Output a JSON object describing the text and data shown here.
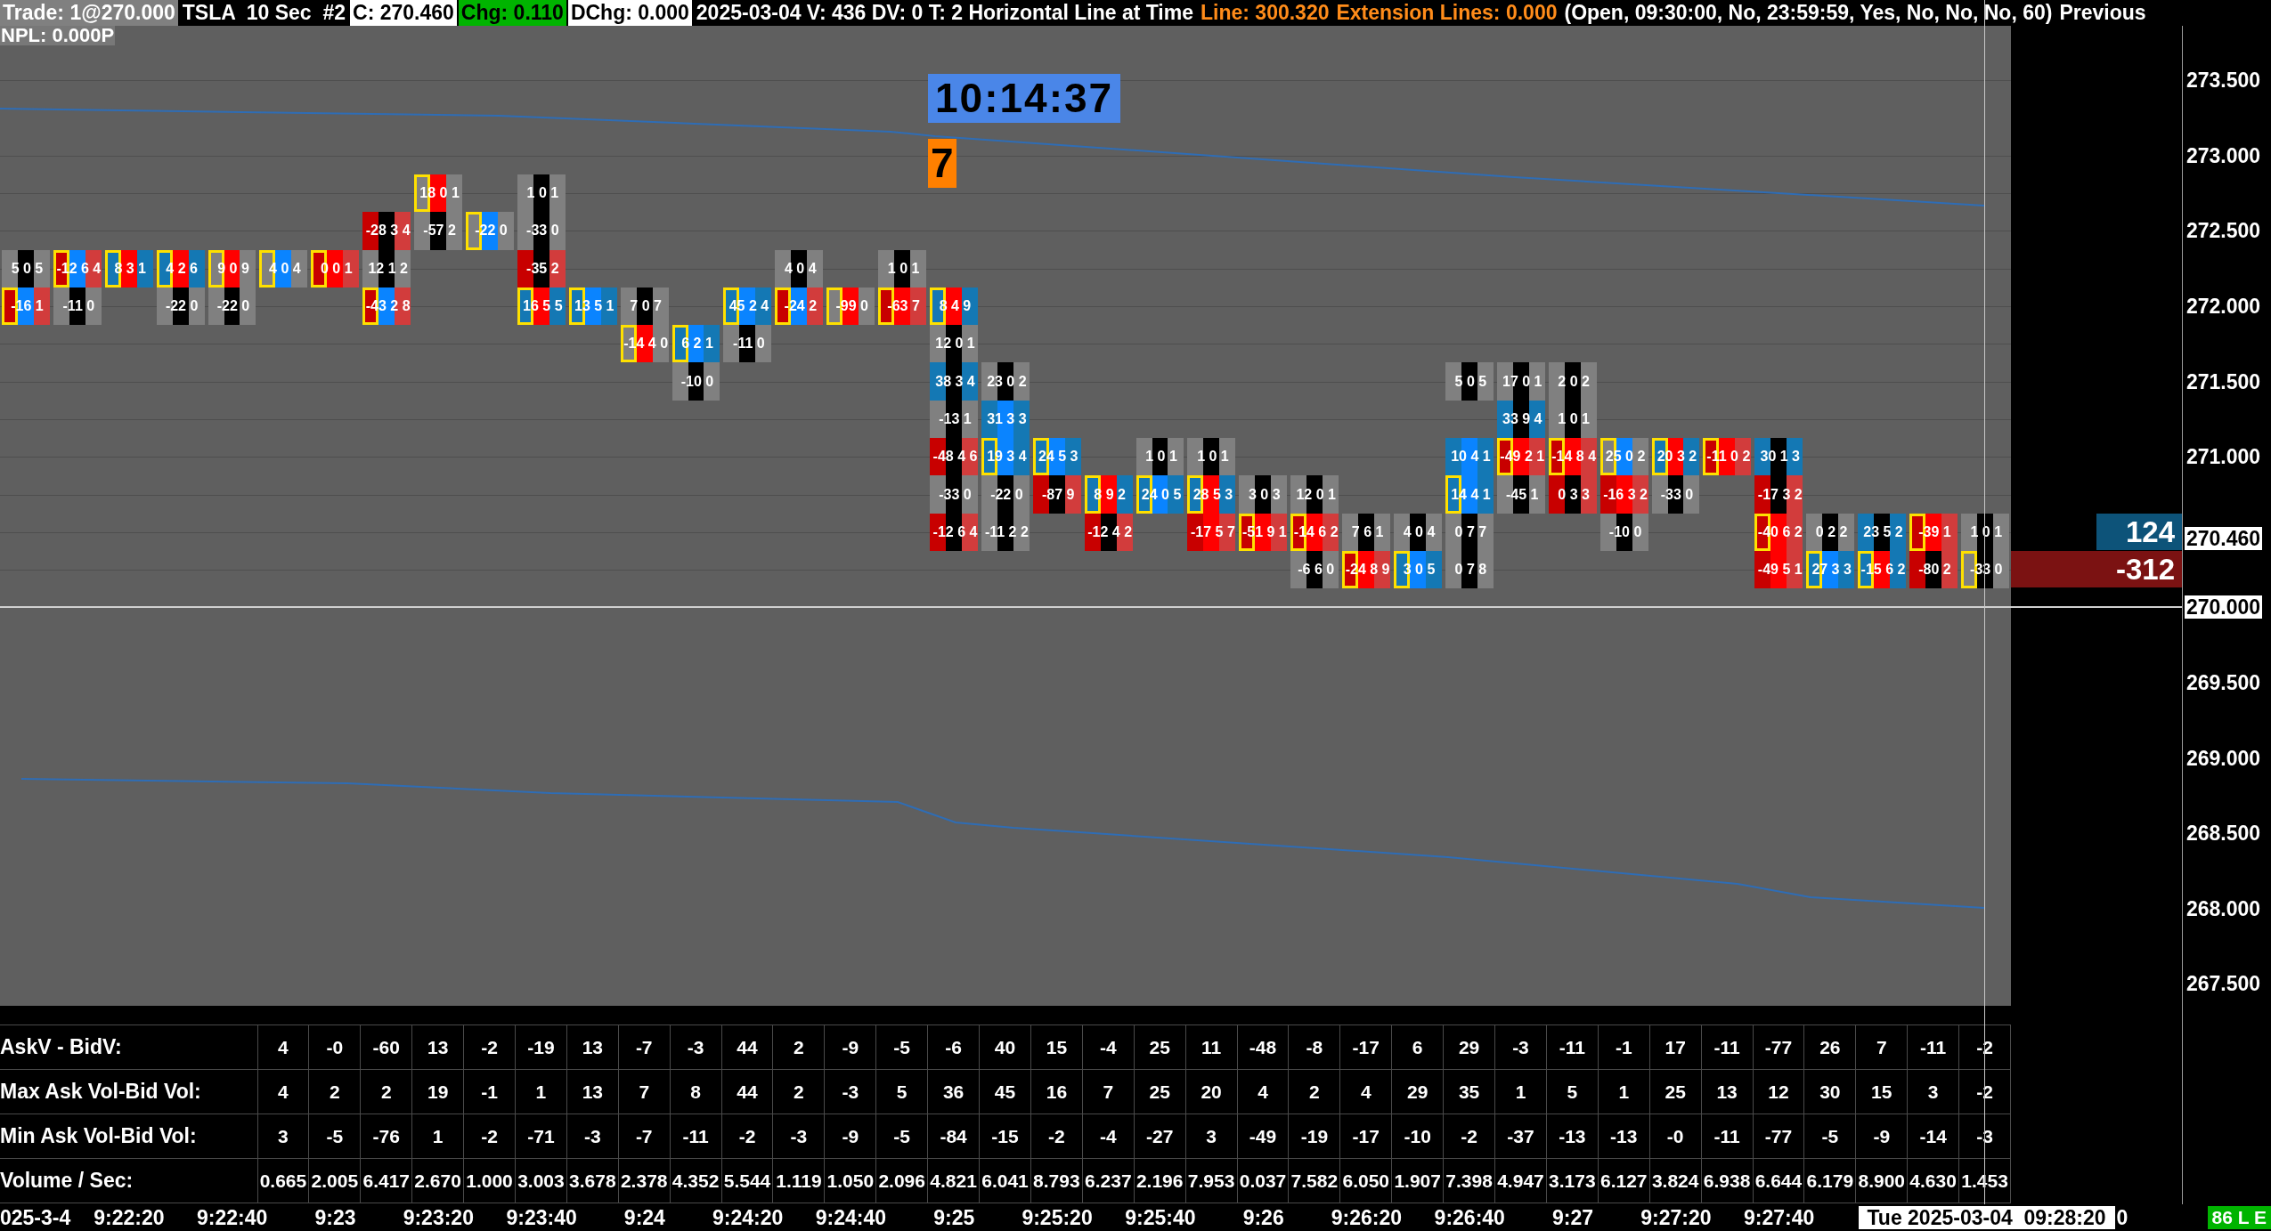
{
  "header": {
    "segments": [
      {
        "text": "Trade: 1@270.000",
        "kind": "muted"
      },
      {
        "text": "TSLA  10 Sec  #2",
        "kind": "inverse"
      },
      {
        "text": "C: 270.460",
        "kind": "light"
      },
      {
        "text": "Chg: 0.110",
        "kind": "positive"
      },
      {
        "text": "DChg: 0.000",
        "kind": "light"
      },
      {
        "text": "2025-03-04 V: 436 DV: 0 T: 2 Horizontal Line at Time",
        "kind": "inverse"
      },
      {
        "text": "Line: 300.320",
        "kind": "accent"
      },
      {
        "text": "Extension Lines: 0.000",
        "kind": "accent"
      },
      {
        "text": "(Open, 09:30:00, No, 23:59:59, Yes, No, No, No, 60)",
        "kind": "inverse"
      },
      {
        "text": "Previous",
        "kind": "inverse"
      }
    ]
  },
  "chart": {
    "pnl": "NPL: 0.000P",
    "timer": "10:14:37",
    "countdown": "7",
    "bars": [
      {
        "cells": [
          {
            "kind": "empty"
          },
          {
            "kind": "empty"
          },
          {
            "text": "5 0 5",
            "kind": "neutral",
            "highlighted": false
          },
          {
            "text": "-16 1",
            "kind": "splitsell",
            "highlighted": true
          }
        ]
      },
      {
        "cells": [
          {
            "kind": "empty"
          },
          {
            "kind": "empty"
          },
          {
            "text": "-12 6 4",
            "kind": "splitsell",
            "highlighted": true
          },
          {
            "text": "-11 0",
            "kind": "neutral",
            "highlighted": false
          }
        ]
      },
      {
        "cells": [
          {
            "kind": "empty"
          },
          {
            "kind": "empty"
          },
          {
            "text": "8 3 1",
            "kind": "splitbuy",
            "highlighted": true
          }
        ]
      },
      {
        "cells": [
          {
            "kind": "empty"
          },
          {
            "kind": "empty"
          },
          {
            "text": "4 2 6",
            "kind": "splitbuy",
            "highlighted": true
          },
          {
            "text": "-22 0",
            "kind": "neutral",
            "highlighted": false
          }
        ]
      },
      {
        "cells": [
          {
            "kind": "empty"
          },
          {
            "kind": "empty"
          },
          {
            "text": "9 0 9",
            "kind": "graysell",
            "highlighted": true
          },
          {
            "text": "-22 0",
            "kind": "neutral",
            "highlighted": false
          }
        ]
      },
      {
        "cells": [
          {
            "kind": "empty"
          },
          {
            "kind": "empty"
          },
          {
            "text": "4 0 4",
            "kind": "graybuy",
            "highlighted": true
          }
        ]
      },
      {
        "cells": [
          {
            "kind": "empty"
          },
          {
            "kind": "empty"
          },
          {
            "text": "0 0 1",
            "kind": "sell",
            "highlighted": true
          }
        ]
      },
      {
        "cells": [
          {
            "kind": "empty"
          },
          {
            "text": "-28 3 4",
            "kind": "thinsell",
            "highlighted": false
          },
          {
            "text": "12 1 2",
            "kind": "neutral",
            "highlighted": false
          },
          {
            "text": "-43 2 8",
            "kind": "splitsell",
            "highlighted": true
          }
        ]
      },
      {
        "cells": [
          {
            "text": "18 0 1",
            "kind": "graysell",
            "highlighted": true
          },
          {
            "text": "-57 2",
            "kind": "neutral",
            "highlighted": false
          }
        ]
      },
      {
        "cells": [
          {
            "kind": "empty"
          },
          {
            "text": "-22 0",
            "kind": "graybuy",
            "highlighted": true
          }
        ]
      },
      {
        "cells": [
          {
            "text": "1 0 1",
            "kind": "neutral",
            "highlighted": false
          },
          {
            "text": "-33 0",
            "kind": "neutral",
            "highlighted": false
          },
          {
            "text": "-35 2",
            "kind": "thinsell",
            "highlighted": false
          },
          {
            "text": "16 5 5",
            "kind": "splitbuy",
            "highlighted": true
          }
        ]
      },
      {
        "cells": [
          {
            "kind": "empty"
          },
          {
            "kind": "empty"
          },
          {
            "kind": "empty"
          },
          {
            "text": "13 5 1",
            "kind": "buy",
            "highlighted": true
          }
        ]
      },
      {
        "cells": [
          {
            "kind": "empty"
          },
          {
            "kind": "empty"
          },
          {
            "kind": "empty"
          },
          {
            "text": "7 0 7",
            "kind": "neutral",
            "highlighted": false
          },
          {
            "text": "-14 4 0",
            "kind": "graysell",
            "highlighted": true
          }
        ]
      },
      {
        "cells": [
          {
            "kind": "empty"
          },
          {
            "kind": "empty"
          },
          {
            "kind": "empty"
          },
          {
            "kind": "empty"
          },
          {
            "text": "6 2 1",
            "kind": "buy",
            "highlighted": true
          },
          {
            "text": "-10 0",
            "kind": "neutral",
            "highlighted": false
          }
        ]
      },
      {
        "cells": [
          {
            "kind": "empty"
          },
          {
            "kind": "empty"
          },
          {
            "kind": "empty"
          },
          {
            "text": "45 2 4",
            "kind": "buy",
            "highlighted": true
          },
          {
            "text": "-11 0",
            "kind": "neutral",
            "highlighted": false
          }
        ]
      },
      {
        "cells": [
          {
            "kind": "empty"
          },
          {
            "kind": "empty"
          },
          {
            "text": "4 0 4",
            "kind": "neutral",
            "highlighted": false
          },
          {
            "text": "-24 2",
            "kind": "splitsell",
            "highlighted": true
          }
        ]
      },
      {
        "cells": [
          {
            "kind": "empty"
          },
          {
            "kind": "empty"
          },
          {
            "kind": "empty"
          },
          {
            "text": "-99 0",
            "kind": "graysell",
            "highlighted": true
          }
        ]
      },
      {
        "cells": [
          {
            "kind": "empty"
          },
          {
            "kind": "empty"
          },
          {
            "text": "1 0 1",
            "kind": "neutral",
            "highlighted": false
          },
          {
            "text": "-63 7",
            "kind": "sell",
            "highlighted": true
          }
        ]
      },
      {
        "cells": [
          {
            "kind": "empty"
          },
          {
            "kind": "empty"
          },
          {
            "kind": "empty"
          },
          {
            "text": "8 4 9",
            "kind": "splitbuy",
            "highlighted": true
          },
          {
            "text": "12 0 1",
            "kind": "neutral",
            "highlighted": false
          },
          {
            "text": "38 3 4",
            "kind": "thinbuy",
            "highlighted": false
          },
          {
            "text": "-13 1",
            "kind": "neutral",
            "highlighted": false
          },
          {
            "text": "-48 4 6",
            "kind": "thinsell",
            "highlighted": false
          },
          {
            "text": "-33 0",
            "kind": "neutral",
            "highlighted": false
          },
          {
            "text": "-12 6 4",
            "kind": "thinsell",
            "highlighted": false
          }
        ]
      },
      {
        "cells": [
          {
            "kind": "empty"
          },
          {
            "kind": "empty"
          },
          {
            "kind": "empty"
          },
          {
            "kind": "empty"
          },
          {
            "kind": "empty"
          },
          {
            "text": "23 0 2",
            "kind": "neutral",
            "highlighted": false
          },
          {
            "text": "31 3 3",
            "kind": "buy",
            "highlighted": false
          },
          {
            "text": "19 3 4",
            "kind": "buy",
            "highlighted": true
          },
          {
            "text": "-22 0",
            "kind": "neutral",
            "highlighted": false
          },
          {
            "text": "-11 2 2",
            "kind": "neutral",
            "highlighted": false
          }
        ]
      },
      {
        "cells": [
          {
            "kind": "empty"
          },
          {
            "kind": "empty"
          },
          {
            "kind": "empty"
          },
          {
            "kind": "empty"
          },
          {
            "kind": "empty"
          },
          {
            "kind": "empty"
          },
          {
            "kind": "empty"
          },
          {
            "text": "24 5 3",
            "kind": "buy",
            "highlighted": true
          },
          {
            "text": "-87 9",
            "kind": "thinsell",
            "highlighted": false
          }
        ]
      },
      {
        "cells": [
          {
            "kind": "empty"
          },
          {
            "kind": "empty"
          },
          {
            "kind": "empty"
          },
          {
            "kind": "empty"
          },
          {
            "kind": "empty"
          },
          {
            "kind": "empty"
          },
          {
            "kind": "empty"
          },
          {
            "kind": "empty"
          },
          {
            "text": "8 9 2",
            "kind": "splitbuy",
            "highlighted": true
          },
          {
            "text": "-12 4 2",
            "kind": "thinsell",
            "highlighted": false
          }
        ]
      },
      {
        "cells": [
          {
            "kind": "empty"
          },
          {
            "kind": "empty"
          },
          {
            "kind": "empty"
          },
          {
            "kind": "empty"
          },
          {
            "kind": "empty"
          },
          {
            "kind": "empty"
          },
          {
            "kind": "empty"
          },
          {
            "text": "1 0 1",
            "kind": "neutral",
            "highlighted": false
          },
          {
            "text": "24 0 5",
            "kind": "buy",
            "highlighted": true
          }
        ]
      },
      {
        "cells": [
          {
            "kind": "empty"
          },
          {
            "kind": "empty"
          },
          {
            "kind": "empty"
          },
          {
            "kind": "empty"
          },
          {
            "kind": "empty"
          },
          {
            "kind": "empty"
          },
          {
            "kind": "empty"
          },
          {
            "text": "1 0 1",
            "kind": "neutral",
            "highlighted": false
          },
          {
            "text": "28 5 3",
            "kind": "splitbuy",
            "highlighted": true
          },
          {
            "text": "-17 5 7",
            "kind": "sell",
            "highlighted": false
          }
        ]
      },
      {
        "cells": [
          {
            "kind": "empty"
          },
          {
            "kind": "empty"
          },
          {
            "kind": "empty"
          },
          {
            "kind": "empty"
          },
          {
            "kind": "empty"
          },
          {
            "kind": "empty"
          },
          {
            "kind": "empty"
          },
          {
            "kind": "empty"
          },
          {
            "text": "3 0 3",
            "kind": "neutral",
            "highlighted": false
          },
          {
            "text": "-51 9 1",
            "kind": "sell",
            "highlighted": true
          }
        ]
      },
      {
        "cells": [
          {
            "kind": "empty"
          },
          {
            "kind": "empty"
          },
          {
            "kind": "empty"
          },
          {
            "kind": "empty"
          },
          {
            "kind": "empty"
          },
          {
            "kind": "empty"
          },
          {
            "kind": "empty"
          },
          {
            "kind": "empty"
          },
          {
            "text": "12 0 1",
            "kind": "neutral",
            "highlighted": false
          },
          {
            "text": "-14 6 2",
            "kind": "sell",
            "highlighted": true
          },
          {
            "text": "-6 6 0",
            "kind": "neutral",
            "highlighted": false
          }
        ]
      },
      {
        "cells": [
          {
            "kind": "empty"
          },
          {
            "kind": "empty"
          },
          {
            "kind": "empty"
          },
          {
            "kind": "empty"
          },
          {
            "kind": "empty"
          },
          {
            "kind": "empty"
          },
          {
            "kind": "empty"
          },
          {
            "kind": "empty"
          },
          {
            "kind": "empty"
          },
          {
            "text": "7 6 1",
            "kind": "neutral",
            "highlighted": false
          },
          {
            "text": "-24 8 9",
            "kind": "sell",
            "highlighted": true
          }
        ]
      },
      {
        "cells": [
          {
            "kind": "empty"
          },
          {
            "kind": "empty"
          },
          {
            "kind": "empty"
          },
          {
            "kind": "empty"
          },
          {
            "kind": "empty"
          },
          {
            "kind": "empty"
          },
          {
            "kind": "empty"
          },
          {
            "kind": "empty"
          },
          {
            "kind": "empty"
          },
          {
            "text": "4 0 4",
            "kind": "neutral",
            "highlighted": false
          },
          {
            "text": "3 0 5",
            "kind": "buy",
            "highlighted": true
          }
        ]
      },
      {
        "cells": [
          {
            "kind": "empty"
          },
          {
            "kind": "empty"
          },
          {
            "kind": "empty"
          },
          {
            "kind": "empty"
          },
          {
            "kind": "empty"
          },
          {
            "text": "5 0 5",
            "kind": "neutral",
            "highlighted": false
          },
          {
            "kind": "empty"
          },
          {
            "text": "10 4 1",
            "kind": "buy",
            "highlighted": false
          },
          {
            "text": "14 4 1",
            "kind": "buy",
            "highlighted": true
          },
          {
            "text": "0 7 7",
            "kind": "neutral",
            "highlighted": false
          },
          {
            "text": "0 7 8",
            "kind": "neutral",
            "highlighted": false
          }
        ]
      },
      {
        "cells": [
          {
            "kind": "empty"
          },
          {
            "kind": "empty"
          },
          {
            "kind": "empty"
          },
          {
            "kind": "empty"
          },
          {
            "kind": "empty"
          },
          {
            "text": "17 0 1",
            "kind": "neutral",
            "highlighted": false
          },
          {
            "text": "33 9 4",
            "kind": "thinbuy",
            "highlighted": false
          },
          {
            "text": "-49 2 1",
            "kind": "sell",
            "highlighted": true
          },
          {
            "text": "-45 1",
            "kind": "neutral",
            "highlighted": false
          }
        ]
      },
      {
        "cells": [
          {
            "kind": "empty"
          },
          {
            "kind": "empty"
          },
          {
            "kind": "empty"
          },
          {
            "kind": "empty"
          },
          {
            "kind": "empty"
          },
          {
            "text": "2 0 2",
            "kind": "neutral",
            "highlighted": false
          },
          {
            "text": "1 0 1",
            "kind": "neutral",
            "highlighted": false
          },
          {
            "text": "-14 8 4",
            "kind": "sell",
            "highlighted": true
          },
          {
            "text": "0 3 3",
            "kind": "thinsell",
            "highlighted": false
          }
        ]
      },
      {
        "cells": [
          {
            "kind": "empty"
          },
          {
            "kind": "empty"
          },
          {
            "kind": "empty"
          },
          {
            "kind": "empty"
          },
          {
            "kind": "empty"
          },
          {
            "kind": "empty"
          },
          {
            "kind": "empty"
          },
          {
            "text": "25 0 2",
            "kind": "graybuy",
            "highlighted": true
          },
          {
            "text": "-16 3 2",
            "kind": "sell",
            "highlighted": false
          },
          {
            "text": "-10 0",
            "kind": "neutral",
            "highlighted": false
          }
        ]
      },
      {
        "cells": [
          {
            "kind": "empty"
          },
          {
            "kind": "empty"
          },
          {
            "kind": "empty"
          },
          {
            "kind": "empty"
          },
          {
            "kind": "empty"
          },
          {
            "kind": "empty"
          },
          {
            "kind": "empty"
          },
          {
            "text": "20 3 2",
            "kind": "splitbuy",
            "highlighted": true
          },
          {
            "text": "-33 0",
            "kind": "neutral",
            "highlighted": false
          }
        ]
      },
      {
        "cells": [
          {
            "kind": "empty"
          },
          {
            "kind": "empty"
          },
          {
            "kind": "empty"
          },
          {
            "kind": "empty"
          },
          {
            "kind": "empty"
          },
          {
            "kind": "empty"
          },
          {
            "kind": "empty"
          },
          {
            "text": "-11 0 2",
            "kind": "sell",
            "highlighted": true
          }
        ]
      },
      {
        "cells": [
          {
            "kind": "empty"
          },
          {
            "kind": "empty"
          },
          {
            "kind": "empty"
          },
          {
            "kind": "empty"
          },
          {
            "kind": "empty"
          },
          {
            "kind": "empty"
          },
          {
            "kind": "empty"
          },
          {
            "text": "30 1 3",
            "kind": "thinbuy",
            "highlighted": false
          },
          {
            "text": "-17 3 2",
            "kind": "thinsell",
            "highlighted": false
          },
          {
            "text": "-40 6 2",
            "kind": "sell",
            "highlighted": true
          },
          {
            "text": "-49 5 1",
            "kind": "sell",
            "highlighted": false
          }
        ]
      },
      {
        "cells": [
          {
            "kind": "empty"
          },
          {
            "kind": "empty"
          },
          {
            "kind": "empty"
          },
          {
            "kind": "empty"
          },
          {
            "kind": "empty"
          },
          {
            "kind": "empty"
          },
          {
            "kind": "empty"
          },
          {
            "kind": "empty"
          },
          {
            "kind": "empty"
          },
          {
            "text": "0 2 2",
            "kind": "neutral",
            "highlighted": false
          },
          {
            "text": "27 3 3",
            "kind": "buy",
            "highlighted": true
          }
        ]
      },
      {
        "cells": [
          {
            "kind": "empty"
          },
          {
            "kind": "empty"
          },
          {
            "kind": "empty"
          },
          {
            "kind": "empty"
          },
          {
            "kind": "empty"
          },
          {
            "kind": "empty"
          },
          {
            "kind": "empty"
          },
          {
            "kind": "empty"
          },
          {
            "kind": "empty"
          },
          {
            "text": "23 5 2",
            "kind": "thinbuy",
            "highlighted": false
          },
          {
            "text": "-15 6 2",
            "kind": "splitbuy",
            "highlighted": true
          }
        ]
      },
      {
        "cells": [
          {
            "kind": "empty"
          },
          {
            "kind": "empty"
          },
          {
            "kind": "empty"
          },
          {
            "kind": "empty"
          },
          {
            "kind": "empty"
          },
          {
            "kind": "empty"
          },
          {
            "kind": "empty"
          },
          {
            "kind": "empty"
          },
          {
            "kind": "empty"
          },
          {
            "text": "-39 1",
            "kind": "sell",
            "highlighted": true
          },
          {
            "text": "-80 2",
            "kind": "thinsell",
            "highlighted": false
          }
        ]
      },
      {
        "cells": [
          {
            "kind": "empty"
          },
          {
            "kind": "empty"
          },
          {
            "kind": "empty"
          },
          {
            "kind": "empty"
          },
          {
            "kind": "empty"
          },
          {
            "kind": "empty"
          },
          {
            "kind": "empty"
          },
          {
            "kind": "empty"
          },
          {
            "kind": "empty"
          },
          {
            "text": "1 0 1",
            "kind": "neutral",
            "highlighted": false
          },
          {
            "text": "-33 0",
            "kind": "neutral",
            "highlighted": true
          }
        ]
      }
    ]
  },
  "side_labels": [
    {
      "text": "124",
      "kind": "buy"
    },
    {
      "text": "-312",
      "kind": "sell"
    }
  ],
  "price_axis": {
    "labels": [
      {
        "text": "273.500",
        "kind": "tick"
      },
      {
        "text": "273.000",
        "kind": "tick"
      },
      {
        "text": "272.500",
        "kind": "tick"
      },
      {
        "text": "272.000",
        "kind": "tick"
      },
      {
        "text": "271.500",
        "kind": "tick"
      },
      {
        "text": "271.000",
        "kind": "tick"
      },
      {
        "text": "270.460",
        "kind": "marker"
      },
      {
        "text": "270.000",
        "kind": "marker"
      },
      {
        "text": "269.500",
        "kind": "tick"
      },
      {
        "text": "269.000",
        "kind": "tick"
      },
      {
        "text": "268.500",
        "kind": "tick"
      },
      {
        "text": "268.000",
        "kind": "tick"
      },
      {
        "text": "267.500",
        "kind": "tick"
      }
    ]
  },
  "table": {
    "rows": [
      {
        "label": "AskV - BidV:",
        "values": [
          "4",
          "-0",
          "-60",
          "13",
          "-2",
          "-19",
          "13",
          "-7",
          "-3",
          "44",
          "2",
          "-9",
          "-5",
          "-6",
          "40",
          "15",
          "-4",
          "25",
          "11",
          "-48",
          "-8",
          "-17",
          "6",
          "29",
          "-3",
          "-11",
          "-1",
          "17",
          "-11",
          "-77",
          "26",
          "7",
          "-11",
          "-2"
        ]
      },
      {
        "label": "Max Ask Vol-Bid Vol:",
        "values": [
          "4",
          "2",
          "2",
          "19",
          "-1",
          "1",
          "13",
          "7",
          "8",
          "44",
          "2",
          "-3",
          "5",
          "36",
          "45",
          "16",
          "7",
          "25",
          "20",
          "4",
          "2",
          "4",
          "29",
          "35",
          "1",
          "5",
          "1",
          "25",
          "13",
          "12",
          "30",
          "15",
          "3",
          "-2"
        ]
      },
      {
        "label": "Min Ask Vol-Bid Vol:",
        "values": [
          "3",
          "-5",
          "-76",
          "1",
          "-2",
          "-71",
          "-3",
          "-7",
          "-11",
          "-2",
          "-3",
          "-9",
          "-5",
          "-84",
          "-15",
          "-2",
          "-4",
          "-27",
          "3",
          "-49",
          "-19",
          "-17",
          "-10",
          "-2",
          "-37",
          "-13",
          "-13",
          "-0",
          "-11",
          "-77",
          "-5",
          "-9",
          "-14",
          "-3"
        ]
      },
      {
        "label": "Volume / Sec:",
        "values": [
          "0.665",
          "2.005",
          "6.417",
          "2.670",
          "1.000",
          "3.003",
          "3.678",
          "2.378",
          "4.352",
          "5.544",
          "1.119",
          "1.050",
          "2.096",
          "4.821",
          "6.041",
          "8.793",
          "6.237",
          "2.196",
          "7.953",
          "0.037",
          "7.582",
          "6.050",
          "1.907",
          "7.398",
          "4.947",
          "3.173",
          "6.127",
          "3.824",
          "6.938",
          "6.644",
          "6.179",
          "8.900",
          "4.630",
          "1.453"
        ]
      }
    ]
  },
  "time_axis": {
    "labels": [
      "025-3-4",
      "9:22:20",
      "9:22:40",
      "9:23",
      "9:23:20",
      "9:23:40",
      "9:24",
      "9:24:20",
      "9:24:40",
      "9:25",
      "9:25:20",
      "9:25:40",
      "9:26",
      "9:26:20",
      "9:26:40",
      "9:27",
      "9:27:20",
      "9:27:40"
    ],
    "cursor": "Tue 2025-03-04  09:28:20",
    "trailing": "0",
    "badge": "86 L E"
  }
}
